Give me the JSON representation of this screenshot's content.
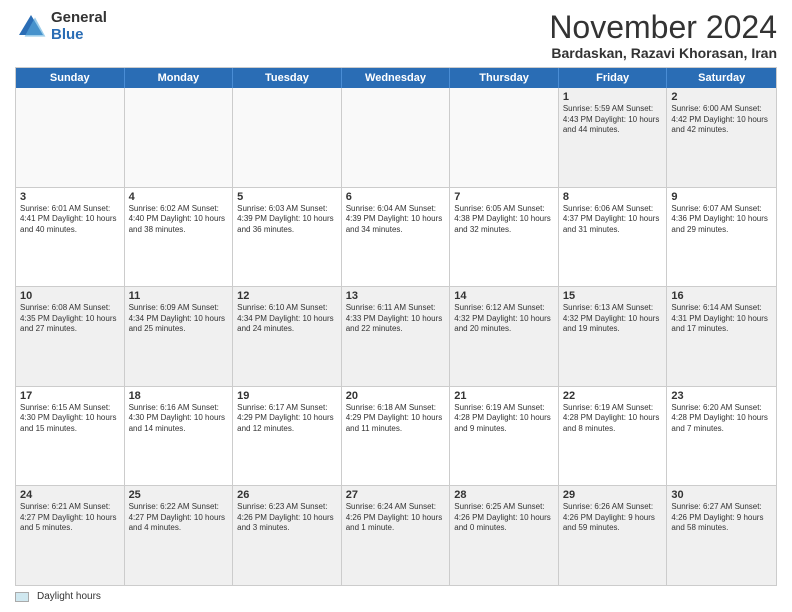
{
  "logo": {
    "general": "General",
    "blue": "Blue"
  },
  "title": "November 2024",
  "subtitle": "Bardaskan, Razavi Khorasan, Iran",
  "days_of_week": [
    "Sunday",
    "Monday",
    "Tuesday",
    "Wednesday",
    "Thursday",
    "Friday",
    "Saturday"
  ],
  "footer": {
    "legend_label": "Daylight hours"
  },
  "weeks": [
    [
      {
        "day": "",
        "info": ""
      },
      {
        "day": "",
        "info": ""
      },
      {
        "day": "",
        "info": ""
      },
      {
        "day": "",
        "info": ""
      },
      {
        "day": "",
        "info": ""
      },
      {
        "day": "1",
        "info": "Sunrise: 5:59 AM\nSunset: 4:43 PM\nDaylight: 10 hours\nand 44 minutes."
      },
      {
        "day": "2",
        "info": "Sunrise: 6:00 AM\nSunset: 4:42 PM\nDaylight: 10 hours\nand 42 minutes."
      }
    ],
    [
      {
        "day": "3",
        "info": "Sunrise: 6:01 AM\nSunset: 4:41 PM\nDaylight: 10 hours\nand 40 minutes."
      },
      {
        "day": "4",
        "info": "Sunrise: 6:02 AM\nSunset: 4:40 PM\nDaylight: 10 hours\nand 38 minutes."
      },
      {
        "day": "5",
        "info": "Sunrise: 6:03 AM\nSunset: 4:39 PM\nDaylight: 10 hours\nand 36 minutes."
      },
      {
        "day": "6",
        "info": "Sunrise: 6:04 AM\nSunset: 4:39 PM\nDaylight: 10 hours\nand 34 minutes."
      },
      {
        "day": "7",
        "info": "Sunrise: 6:05 AM\nSunset: 4:38 PM\nDaylight: 10 hours\nand 32 minutes."
      },
      {
        "day": "8",
        "info": "Sunrise: 6:06 AM\nSunset: 4:37 PM\nDaylight: 10 hours\nand 31 minutes."
      },
      {
        "day": "9",
        "info": "Sunrise: 6:07 AM\nSunset: 4:36 PM\nDaylight: 10 hours\nand 29 minutes."
      }
    ],
    [
      {
        "day": "10",
        "info": "Sunrise: 6:08 AM\nSunset: 4:35 PM\nDaylight: 10 hours\nand 27 minutes."
      },
      {
        "day": "11",
        "info": "Sunrise: 6:09 AM\nSunset: 4:34 PM\nDaylight: 10 hours\nand 25 minutes."
      },
      {
        "day": "12",
        "info": "Sunrise: 6:10 AM\nSunset: 4:34 PM\nDaylight: 10 hours\nand 24 minutes."
      },
      {
        "day": "13",
        "info": "Sunrise: 6:11 AM\nSunset: 4:33 PM\nDaylight: 10 hours\nand 22 minutes."
      },
      {
        "day": "14",
        "info": "Sunrise: 6:12 AM\nSunset: 4:32 PM\nDaylight: 10 hours\nand 20 minutes."
      },
      {
        "day": "15",
        "info": "Sunrise: 6:13 AM\nSunset: 4:32 PM\nDaylight: 10 hours\nand 19 minutes."
      },
      {
        "day": "16",
        "info": "Sunrise: 6:14 AM\nSunset: 4:31 PM\nDaylight: 10 hours\nand 17 minutes."
      }
    ],
    [
      {
        "day": "17",
        "info": "Sunrise: 6:15 AM\nSunset: 4:30 PM\nDaylight: 10 hours\nand 15 minutes."
      },
      {
        "day": "18",
        "info": "Sunrise: 6:16 AM\nSunset: 4:30 PM\nDaylight: 10 hours\nand 14 minutes."
      },
      {
        "day": "19",
        "info": "Sunrise: 6:17 AM\nSunset: 4:29 PM\nDaylight: 10 hours\nand 12 minutes."
      },
      {
        "day": "20",
        "info": "Sunrise: 6:18 AM\nSunset: 4:29 PM\nDaylight: 10 hours\nand 11 minutes."
      },
      {
        "day": "21",
        "info": "Sunrise: 6:19 AM\nSunset: 4:28 PM\nDaylight: 10 hours\nand 9 minutes."
      },
      {
        "day": "22",
        "info": "Sunrise: 6:19 AM\nSunset: 4:28 PM\nDaylight: 10 hours\nand 8 minutes."
      },
      {
        "day": "23",
        "info": "Sunrise: 6:20 AM\nSunset: 4:28 PM\nDaylight: 10 hours\nand 7 minutes."
      }
    ],
    [
      {
        "day": "24",
        "info": "Sunrise: 6:21 AM\nSunset: 4:27 PM\nDaylight: 10 hours\nand 5 minutes."
      },
      {
        "day": "25",
        "info": "Sunrise: 6:22 AM\nSunset: 4:27 PM\nDaylight: 10 hours\nand 4 minutes."
      },
      {
        "day": "26",
        "info": "Sunrise: 6:23 AM\nSunset: 4:26 PM\nDaylight: 10 hours\nand 3 minutes."
      },
      {
        "day": "27",
        "info": "Sunrise: 6:24 AM\nSunset: 4:26 PM\nDaylight: 10 hours\nand 1 minute."
      },
      {
        "day": "28",
        "info": "Sunrise: 6:25 AM\nSunset: 4:26 PM\nDaylight: 10 hours\nand 0 minutes."
      },
      {
        "day": "29",
        "info": "Sunrise: 6:26 AM\nSunset: 4:26 PM\nDaylight: 9 hours\nand 59 minutes."
      },
      {
        "day": "30",
        "info": "Sunrise: 6:27 AM\nSunset: 4:26 PM\nDaylight: 9 hours\nand 58 minutes."
      }
    ]
  ]
}
